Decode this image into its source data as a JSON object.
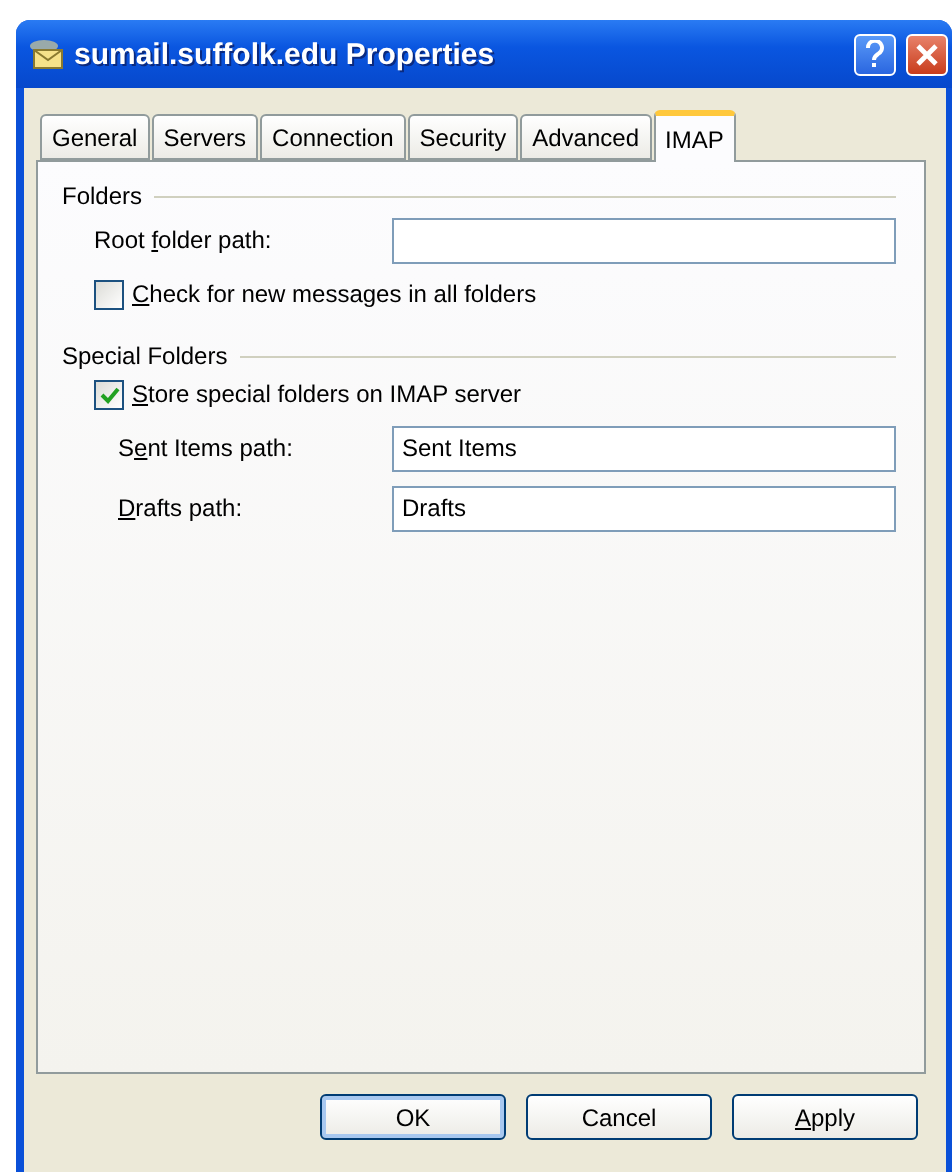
{
  "window": {
    "title": "sumail.suffolk.edu Properties"
  },
  "tabs": [
    {
      "label": "General",
      "selected": false
    },
    {
      "label": "Servers",
      "selected": false
    },
    {
      "label": "Connection",
      "selected": false
    },
    {
      "label": "Security",
      "selected": false
    },
    {
      "label": "Advanced",
      "selected": false
    },
    {
      "label": "IMAP",
      "selected": true
    }
  ],
  "groups": [
    {
      "title": "Folders",
      "items": [
        {
          "kind": "field",
          "label": {
            "before": "Root ",
            "key": "f",
            "after": "older path:"
          },
          "value": "",
          "indent": false
        },
        {
          "kind": "checkbox",
          "label": {
            "key": "C",
            "after": "heck for new messages in all folders"
          },
          "checked": false
        }
      ]
    },
    {
      "title": "Special Folders",
      "items": [
        {
          "kind": "checkbox",
          "label": {
            "key": "S",
            "after": "tore special folders on IMAP server"
          },
          "checked": true
        },
        {
          "kind": "field",
          "label": {
            "before": "S",
            "key": "e",
            "after": "nt Items path:"
          },
          "value": "Sent Items",
          "indent": true
        },
        {
          "kind": "field",
          "label": {
            "key": "D",
            "after": "rafts path:"
          },
          "value": "Drafts",
          "indent": true
        }
      ]
    }
  ],
  "buttons": [
    {
      "label": {
        "after": "OK"
      },
      "default": true
    },
    {
      "label": {
        "after": "Cancel"
      },
      "default": false
    },
    {
      "label": {
        "key": "A",
        "after": "pply"
      },
      "default": false
    }
  ]
}
